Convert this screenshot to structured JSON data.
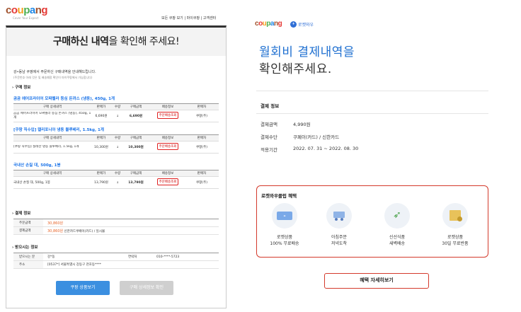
{
  "left": {
    "logo": {
      "chars": [
        "c",
        "o",
        "u",
        "p",
        "a",
        "n",
        "g"
      ],
      "tagline": "Cover Your Expect"
    },
    "toplinks": "모든 쿠팡 보기 | 마이쿠팡 | 고객센터",
    "header": {
      "bold": "구매하신 내역",
      "rest": "을 확인해 주세요!"
    },
    "greeting": "강•동남 쿠팡에서 주문하신 구매내역을 안내해드립니다.",
    "greeting2": "(주문번호 아래 것은 및 배송예정 확인이 마이쿠팡에서 가능합니다)",
    "section_purchase": "› 구매 정보",
    "columns": [
      "구매 상세내역",
      "판매가",
      "수량",
      "구매금액",
      "배송정보",
      "판매자"
    ],
    "products": [
      {
        "name": "곰곰 에어프라이어 모짜렐라 등심 돈까스 (냉동), 450g, 1개",
        "detail": "곰곰 에어프라이어 모짜렐라 등심 돈까스 (냉동), 450g, 1개",
        "price": "6,690원",
        "qty": "1",
        "total": "6,690원",
        "ship": "주문배송조회",
        "seller": "쿠팡(주)"
      },
      {
        "name": "[쿠팡 직수입] 캘리포니아 냉동 블루베리, 1.5kg, 1개",
        "detail": "[쿠팡 직수입] 칠레산 냉동 블루베리, 1.5kg, 1개",
        "price": "10,300원",
        "qty": "1",
        "total": "10,300원",
        "ship": "주문배송조회",
        "seller": "쿠팡(주)"
      },
      {
        "name": "국내산 손질 대, 500g, 1봉",
        "detail": "국내산 손질 대, 500g, 1봉",
        "price": "13,790원",
        "qty": "1",
        "total": "13,790원",
        "ship": "주문배송조회",
        "seller": "쿠팡(주)"
      }
    ],
    "section_payment": "› 결제 정보",
    "payment": [
      {
        "k": "주문금액",
        "v": "30,860원",
        "extra": ""
      },
      {
        "k": "결제금액",
        "v": "30,860원",
        "extra": " 신한카드쿠페이(카드) / 일시불"
      }
    ],
    "section_recipient": "› 받으시는 정보",
    "recipient": [
      {
        "k": "받으시는 분",
        "v": "강*동",
        "k2": "연락처",
        "v2": "010-****-5723"
      },
      {
        "k": "주소",
        "v": "[0537*] 서울특별시 강동구 천호동****",
        "k2": "",
        "v2": ""
      }
    ],
    "btn_primary": "쿠팡 상품보기",
    "btn_secondary": "구매 상세정보 확인"
  },
  "right": {
    "logo_chars": [
      "c",
      "o",
      "u",
      "p",
      "a",
      "n",
      "g"
    ],
    "badge": "로켓와우",
    "title_line1": "월회비 결제내역을",
    "title_line2": "확인해주세요.",
    "section_payment": "결제 정보",
    "rows": [
      {
        "k": "결제금액",
        "v": "4,990원"
      },
      {
        "k": "결제수단",
        "v": "쿠페이(카드) / 신한카드"
      },
      {
        "k": "적용기간",
        "v": "2022. 07. 31 ~ 2022. 08. 30"
      }
    ],
    "benefit_title": "로켓와우클럽 혜택",
    "benefits": [
      {
        "icon": "card-icon",
        "l1": "로켓상품",
        "l2": "100% 무료배송"
      },
      {
        "icon": "truck-icon",
        "l1": "아침주문",
        "l2": "저녁도착"
      },
      {
        "icon": "rocket-icon",
        "l1": "신선식품",
        "l2": "새벽배송"
      },
      {
        "icon": "box-icon",
        "l1": "로켓상품",
        "l2": "30일 무료반품"
      }
    ],
    "more_button": "혜택 자세히보기",
    "colors": {
      "accent_red": "#d43a2c",
      "title_blue": "#1e6fd0"
    }
  }
}
